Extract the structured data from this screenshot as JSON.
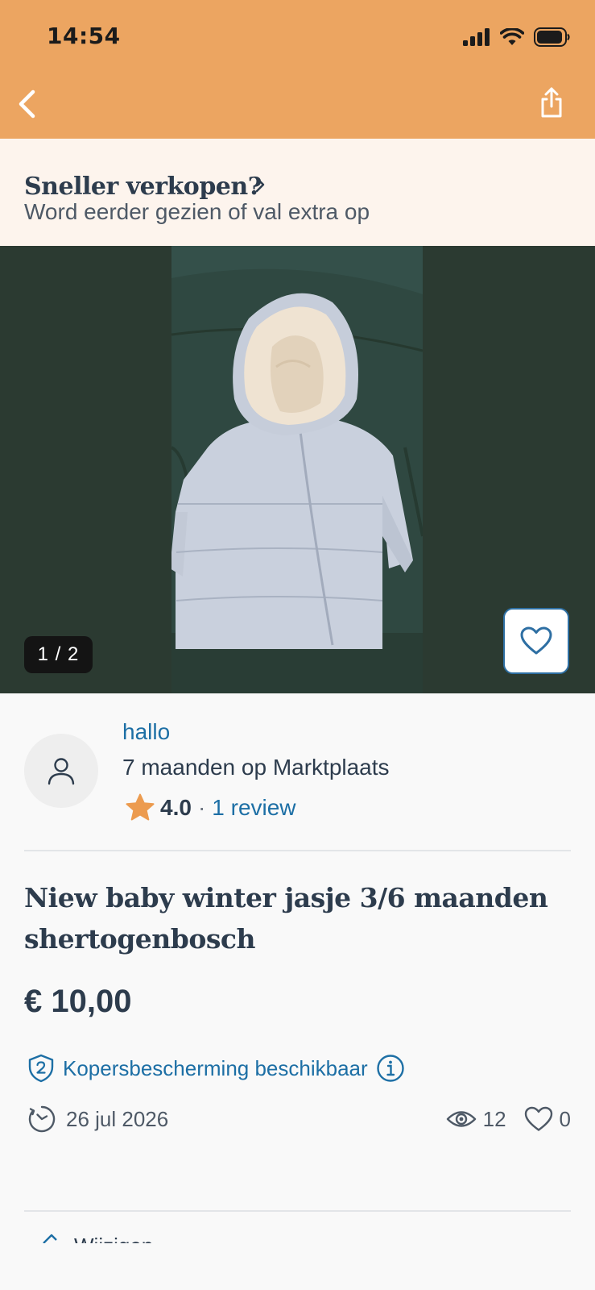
{
  "status_bar": {
    "time": "14:54"
  },
  "promo": {
    "title": "Sneller verkopen?",
    "subtitle": "Word eerder gezien of val extra op"
  },
  "gallery": {
    "counter": "1 / 2"
  },
  "seller": {
    "name": "hallo",
    "since": "7 maanden op Marktplaats",
    "rating": "4.0",
    "separator": "·",
    "reviews": "1 review"
  },
  "listing": {
    "title": "Niew baby winter jasje 3/6 maanden shertogenbosch",
    "price": "€ 10,00",
    "protection": "Kopersbescherming beschikbaar",
    "date": "26 jul 2026",
    "views": "12",
    "favorites": "0"
  },
  "next_section": {
    "label": "Wijzigen"
  },
  "colors": {
    "header": "#eca561",
    "promo_bg": "#fdf4ed",
    "link": "#1d6fa5",
    "text": "#2d3c4d",
    "star": "#ec9b4f",
    "gallery_bg": "#2b3a31"
  }
}
